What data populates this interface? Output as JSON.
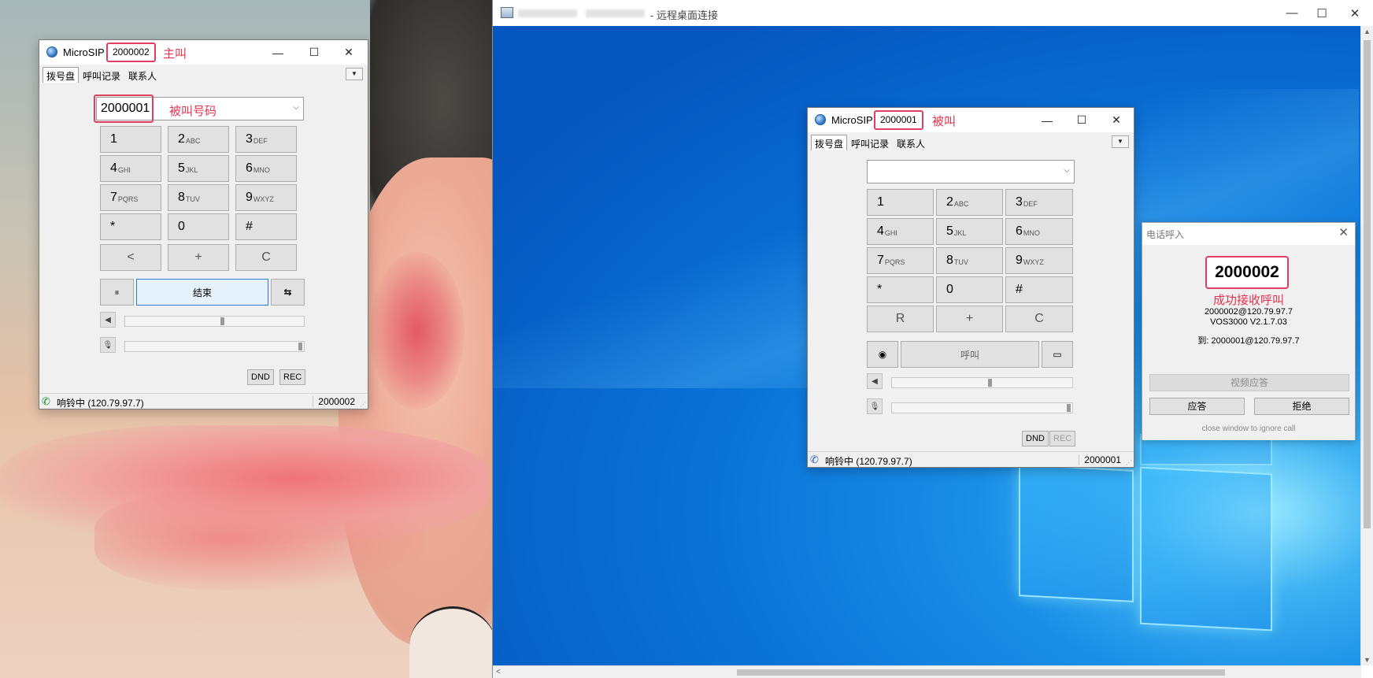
{
  "rdp": {
    "title": "- 远程桌面连接",
    "minimize": "—",
    "maximize": "☐",
    "close": "✕"
  },
  "caller": {
    "app_name": "MicroSIP",
    "dash": "-",
    "account": "2000002",
    "role_label": "主叫",
    "tabs": [
      "拨号盘",
      "呼叫记录",
      "联系人"
    ],
    "dial_value": "2000001",
    "dial_annotation": "被叫号码",
    "keys": [
      {
        "d": "1",
        "l": ""
      },
      {
        "d": "2",
        "l": "ABC"
      },
      {
        "d": "3",
        "l": "DEF"
      },
      {
        "d": "4",
        "l": "GHI"
      },
      {
        "d": "5",
        "l": "JKL"
      },
      {
        "d": "6",
        "l": "MNO"
      },
      {
        "d": "7",
        "l": "PQRS"
      },
      {
        "d": "8",
        "l": "TUV"
      },
      {
        "d": "9",
        "l": "WXYZ"
      },
      {
        "d": "*",
        "l": ""
      },
      {
        "d": "0",
        "l": ""
      },
      {
        "d": "#",
        "l": ""
      }
    ],
    "row5": [
      "<",
      "+",
      "C"
    ],
    "hold_icon": "⏸",
    "end_label": "结束",
    "transfer_icon": "⇆",
    "dnd": "DND",
    "rec": "REC",
    "status_icon": "phone-icon",
    "status_text": "响铃中 (120.79.97.7)",
    "status_account": "2000002",
    "speaker_level": 0.55,
    "mic_level": 1.0
  },
  "callee": {
    "app_name": "MicroSIP",
    "dash": "-",
    "account": "2000001",
    "role_label": "被叫",
    "tabs": [
      "拨号盘",
      "呼叫记录",
      "联系人"
    ],
    "dial_value": "",
    "keys": [
      {
        "d": "1",
        "l": ""
      },
      {
        "d": "2",
        "l": "ABC"
      },
      {
        "d": "3",
        "l": "DEF"
      },
      {
        "d": "4",
        "l": "GHI"
      },
      {
        "d": "5",
        "l": "JKL"
      },
      {
        "d": "6",
        "l": "MNO"
      },
      {
        "d": "7",
        "l": "PQRS"
      },
      {
        "d": "8",
        "l": "TUV"
      },
      {
        "d": "9",
        "l": "WXYZ"
      },
      {
        "d": "*",
        "l": ""
      },
      {
        "d": "0",
        "l": ""
      },
      {
        "d": "#",
        "l": ""
      }
    ],
    "row5": [
      "R",
      "+",
      "C"
    ],
    "call_label": "呼叫",
    "dnd": "DND",
    "rec": "REC",
    "status_text": "响铃中 (120.79.97.7)",
    "status_account": "2000001",
    "speaker_level": 0.55,
    "mic_level": 1.0
  },
  "popup": {
    "title": "电话呼入",
    "close": "✕",
    "number": "2000002",
    "annotation": "成功接收呼叫",
    "from_line": "2000002@120.79.97.7",
    "agent_line": "VOS3000 V2.1.7.03",
    "to_line": "到: 2000001@120.79.97.7",
    "video_answer": "视频应答",
    "answer": "应答",
    "reject": "拒绝",
    "hint": "close window to ignore call"
  },
  "colors": {
    "annotation_red": "#e5334f",
    "highlight_border": "#e04060",
    "status_phone_green": "#1a8a2c"
  }
}
